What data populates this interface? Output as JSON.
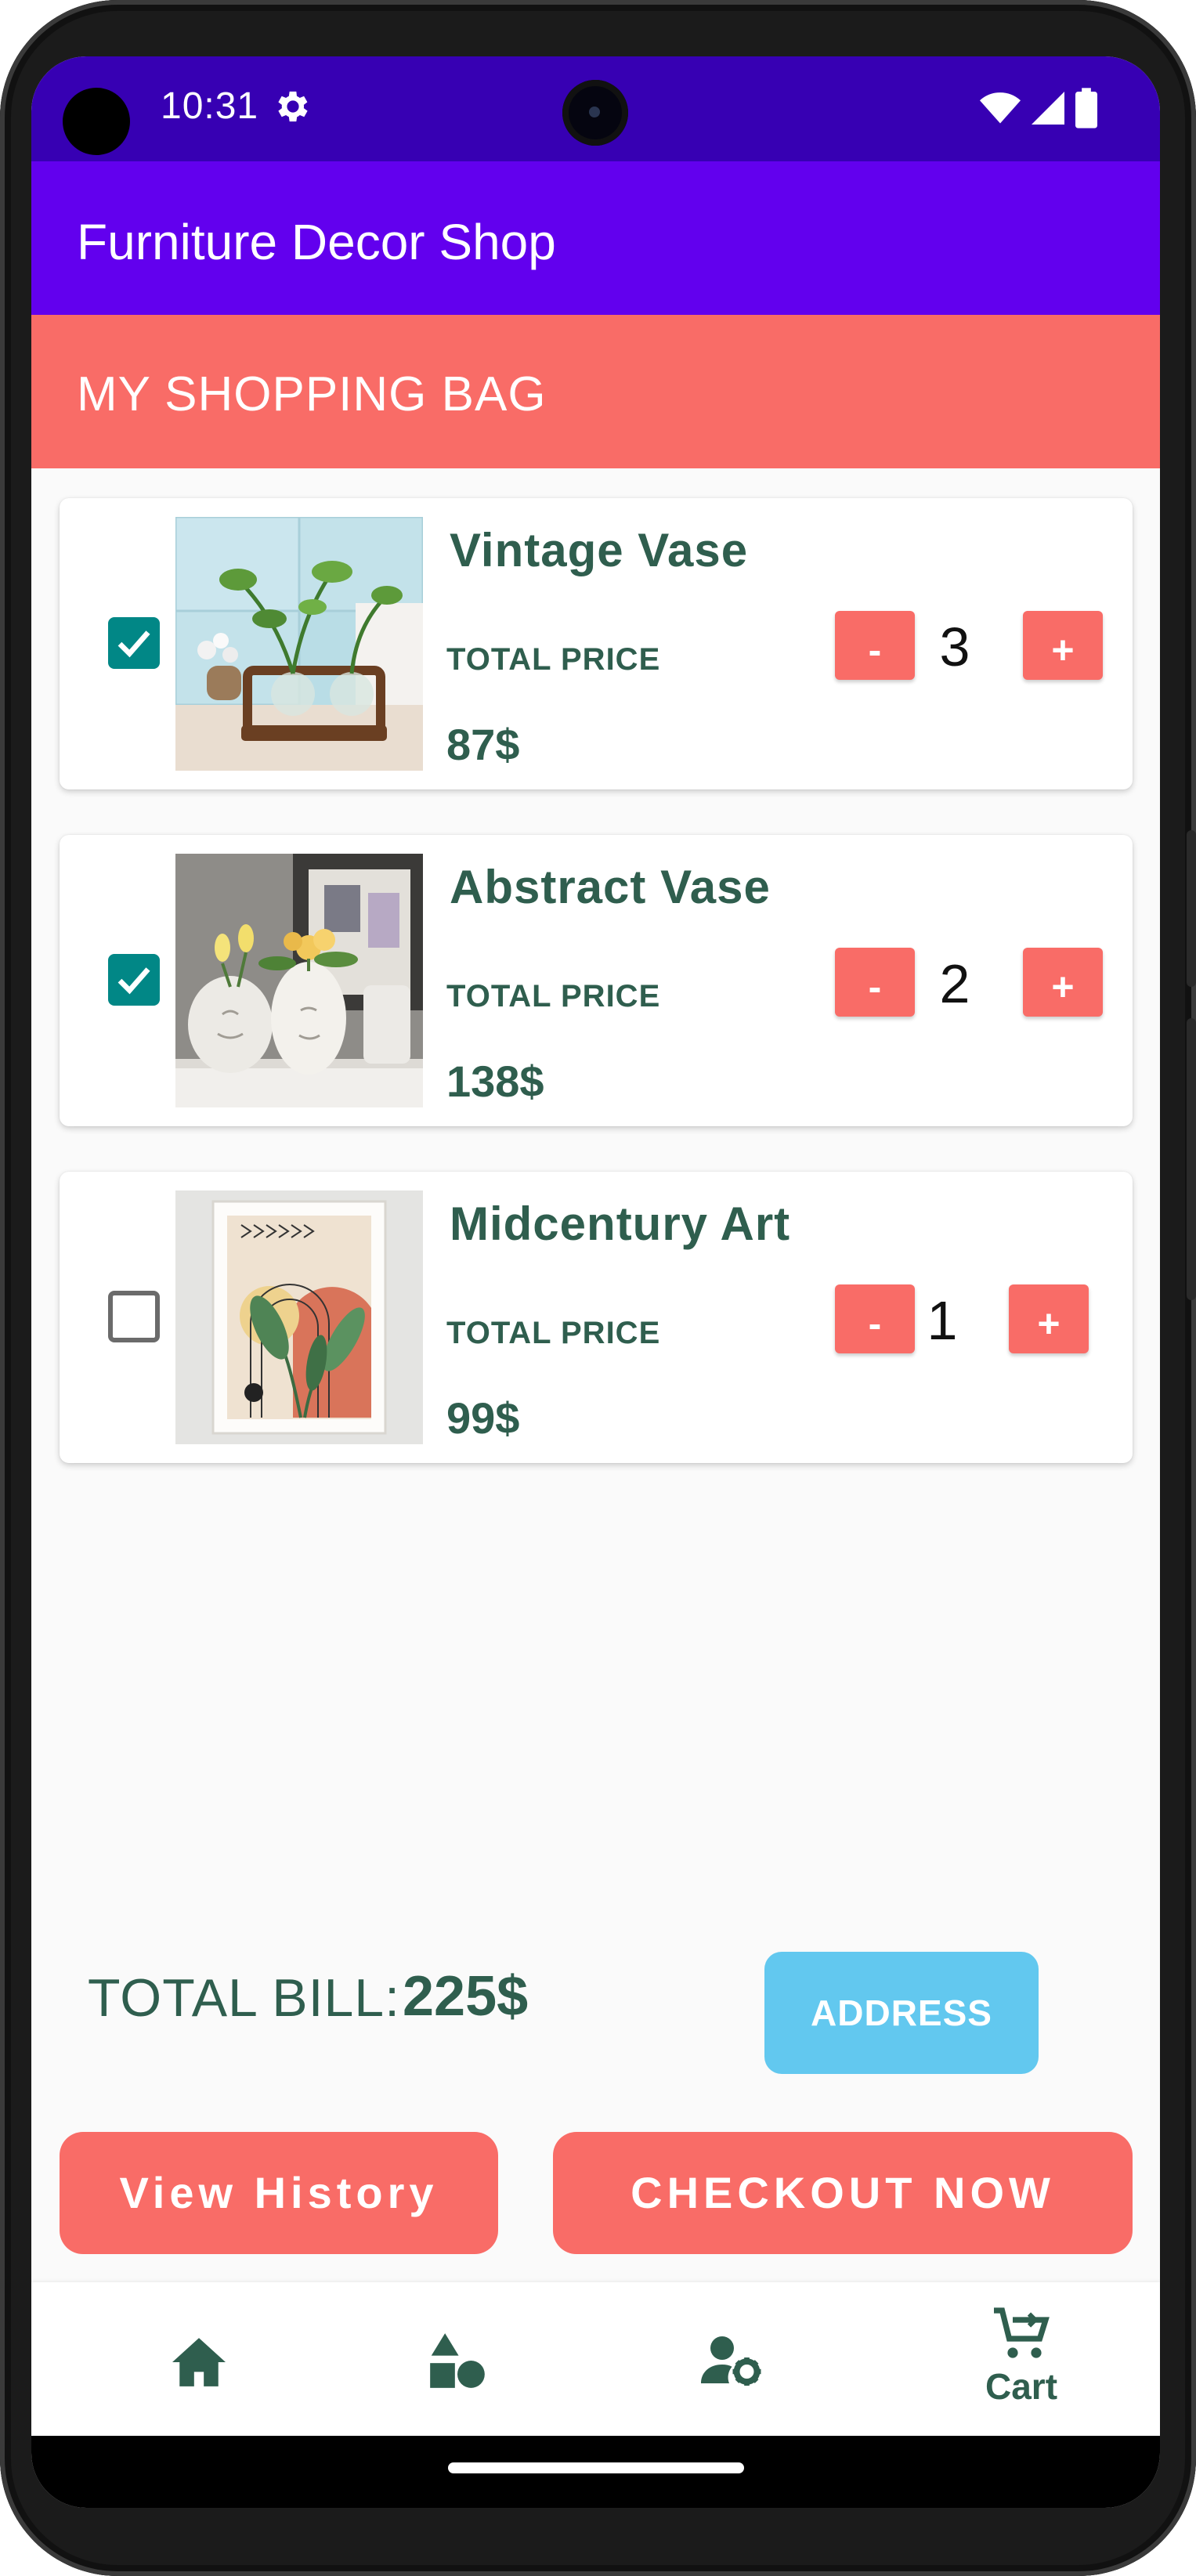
{
  "status_bar": {
    "time": "10:31"
  },
  "app_bar": {
    "title": "Furniture Decor Shop"
  },
  "section": {
    "title": "MY SHOPPING BAG"
  },
  "cart_items": [
    {
      "name": "Vintage Vase",
      "price_label": "TOTAL PRICE",
      "price": "87$",
      "quantity": "3",
      "checked": true,
      "minus_label": "-",
      "plus_label": "+"
    },
    {
      "name": "Abstract Vase",
      "price_label": "TOTAL PRICE",
      "price": "138$",
      "quantity": "2",
      "checked": true,
      "minus_label": "-",
      "plus_label": "+"
    },
    {
      "name": "Midcentury Art",
      "price_label": "TOTAL PRICE",
      "price": "99$",
      "quantity": "1",
      "checked": false,
      "minus_label": "-",
      "plus_label": "+"
    }
  ],
  "summary": {
    "bill_label": "TOTAL BILL:",
    "bill_value": "225$",
    "address_button": "ADDRESS",
    "history_button": "View History",
    "checkout_button": "CHECKOUT NOW"
  },
  "bottom_nav": {
    "items": [
      {
        "icon": "home-icon"
      },
      {
        "icon": "categories-icon"
      },
      {
        "icon": "account-settings-icon"
      },
      {
        "icon": "cart-icon",
        "label": "Cart",
        "selected": true
      }
    ]
  },
  "colors": {
    "status_bar": "#3700b3",
    "app_bar": "#6200ee",
    "accent_coral": "#f96c67",
    "text_green": "#2f5e4e",
    "address_blue": "#62c8ef",
    "checkbox_teal": "#018786"
  }
}
